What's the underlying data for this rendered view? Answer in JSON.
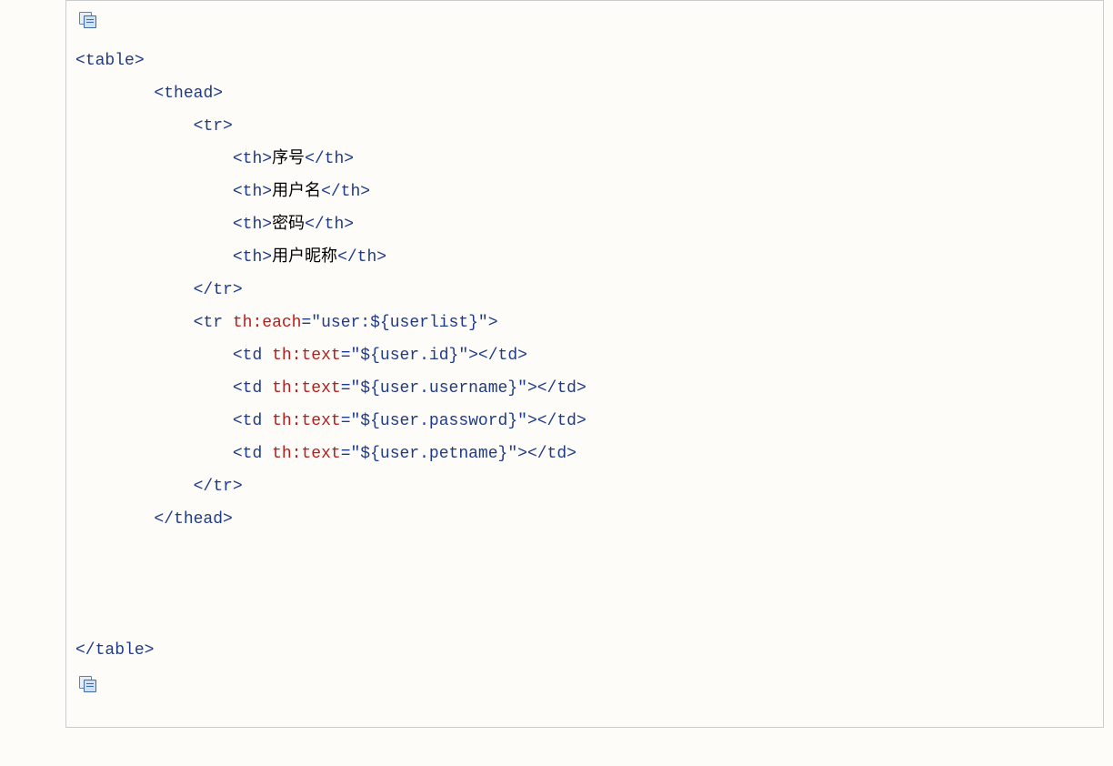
{
  "code": {
    "tags": {
      "table": "table",
      "thead": "thead",
      "tr": "tr",
      "th": "th",
      "td": "td"
    },
    "attrs": {
      "th_each": "th:each",
      "th_text": "th:text"
    },
    "values": {
      "each_expr": "\"user:${userlist}\"",
      "td_id": "\"${user.id}\"",
      "td_username": "\"${user.username}\"",
      "td_password": "\"${user.password}\"",
      "td_petname": "\"${user.petname}\""
    },
    "headers": {
      "col1": "序号",
      "col2": "用户名",
      "col3": "密码",
      "col4": "用户昵称"
    }
  }
}
